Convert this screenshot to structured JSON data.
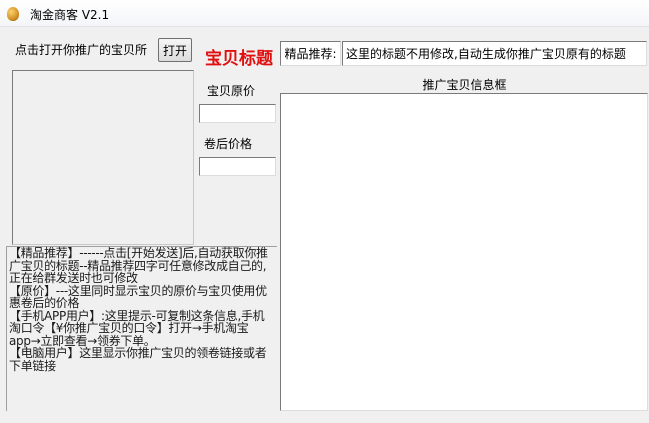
{
  "window": {
    "title": "淘金商客  V2.1",
    "icon": "gold-coin-icon"
  },
  "left_panel": {
    "link_label": "点击打开你推广的宝贝所",
    "open_button": "打开"
  },
  "title_section": {
    "heading": "宝贝标题",
    "recommend_label": "精品推荐:",
    "recommend_value": "这里的标题不用修改,自动生成你推广宝贝原有的标题"
  },
  "price_section": {
    "original_price_label": "宝贝原价",
    "original_price_value": "",
    "coupon_price_label": "卷后价格",
    "coupon_price_value": ""
  },
  "info_frame": {
    "header": "推广宝贝信息框",
    "content": ""
  },
  "help": {
    "lines": [
      "【精品推荐】------点击[开始发送]后,自动获取你推广宝贝的标题--精品推荐四字可任意修改成自己的,正在给群发送时也可修改",
      "【原价】---这里同时显示宝贝的原价与宝贝使用优惠卷后的价格",
      "【手机APP用户】:这里提示-可复制这条信息,手机淘口令【¥你推广宝贝的口令】打开→手机淘宝app→立即查看→领券下单。",
      "【电脑用户】这里显示你推广宝贝的领卷链接或者下单链接"
    ]
  },
  "colors": {
    "heading": "#e01010",
    "background": "#f0f0f0"
  }
}
